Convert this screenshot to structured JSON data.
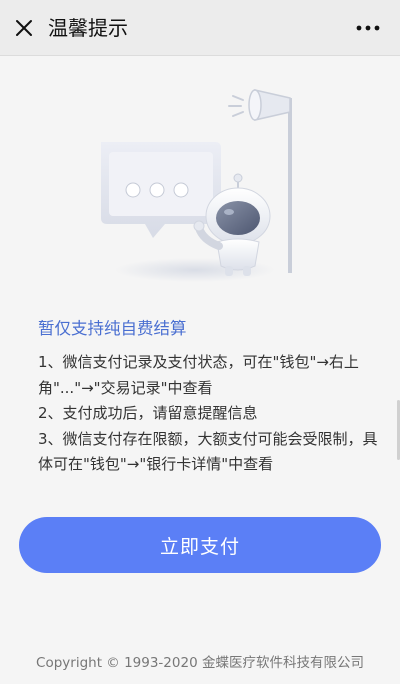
{
  "header": {
    "title": "温馨提示",
    "close_icon": "close-icon",
    "more_icon": "more-icon"
  },
  "main": {
    "headline": "暂仅支持纯自费结算",
    "notes": [
      "1、微信支付记录及支付状态，可在\"钱包\"→右上角\"...\"→\"交易记录\"中查看",
      "2、支付成功后，请留意提醒信息",
      "3、微信支付存在限额，大额支付可能会受限制，具体可在\"钱包\"→\"银行卡详情\"中查看"
    ],
    "pay_button_label": "立即支付"
  },
  "footer": {
    "copyright": "Copyright © 1993-2020 金蝶医疗软件科技有限公司"
  },
  "colors": {
    "accent": "#5b7ff6",
    "headline": "#4a6fd1"
  }
}
